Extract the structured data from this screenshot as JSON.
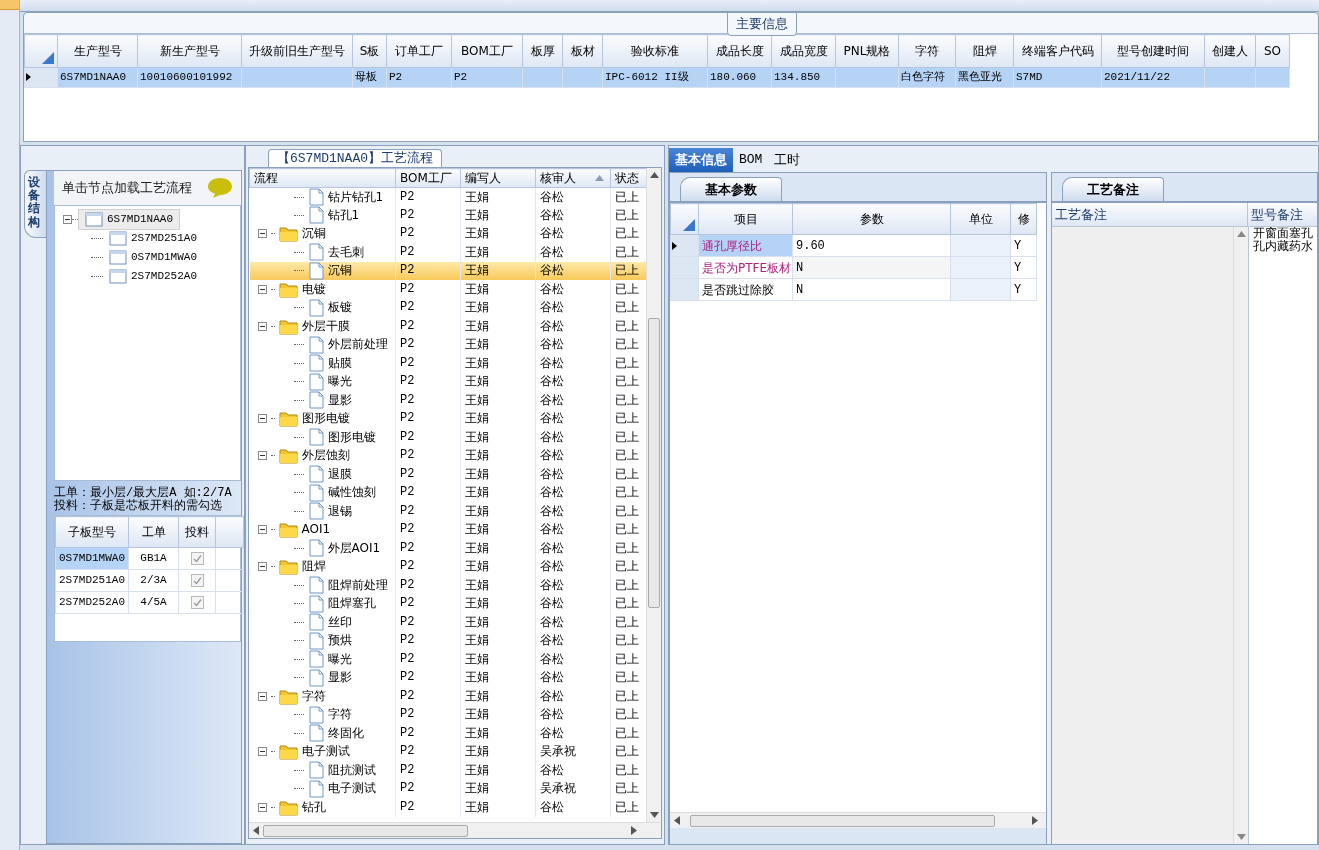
{
  "main_info": {
    "title": "主要信息",
    "columns": [
      "生产型号",
      "新生产型号",
      "升级前旧生产型号",
      "S板",
      "订单工厂",
      "BOM工厂",
      "板厚",
      "板材",
      "验收标准",
      "成品长度",
      "成品宽度",
      "PNL规格",
      "字符",
      "阻焊",
      "终端客户代码",
      "型号创建时间",
      "创建人",
      "SO"
    ],
    "rows": [
      {
        "selected": true,
        "cells": [
          "6S7MD1NAA0",
          "10010600101992",
          null,
          "母板",
          "P2",
          "P2",
          null,
          null,
          "IPC-6012 II级",
          "180.060",
          "134.850",
          null,
          "白色字符",
          "黑色亚光",
          "S7MD",
          "2021/11/22",
          null,
          null
        ]
      }
    ]
  },
  "structure_panel": {
    "side_tab": "设备结构",
    "hint": "单击节点加载工艺流程",
    "tree": [
      {
        "label": "6S7MD1NAA0",
        "expanded": true,
        "selected": true,
        "children": [
          {
            "label": "2S7MD251A0",
            "selected": false
          },
          {
            "label": "0S7MD1MWA0",
            "selected": false
          },
          {
            "label": "2S7MD252A0",
            "selected": false
          }
        ]
      }
    ],
    "notes": [
      "工单：最小层/最大层A 如:2/7A",
      "投料：子板是芯板开料的需勾选"
    ],
    "sub_boards": {
      "columns": [
        "子板型号",
        "工单",
        "投料"
      ],
      "rows": [
        {
          "model": "0S7MD1MWA0",
          "work_order": "GB1A",
          "feed": true,
          "selected": true
        },
        {
          "model": "2S7MD251A0",
          "work_order": "2/3A",
          "feed": true,
          "selected": false
        },
        {
          "model": "2S7MD252A0",
          "work_order": "4/5A",
          "feed": true,
          "selected": false
        }
      ]
    }
  },
  "process": {
    "title": "【6S7MD1NAA0】工艺流程",
    "columns": [
      {
        "label": "流程"
      },
      {
        "label": "BOM工厂"
      },
      {
        "label": "编写人"
      },
      {
        "label": "核审人",
        "sorted": true
      },
      {
        "label": "状态"
      }
    ],
    "rows": [
      {
        "kind": "continued",
        "children": [
          {
            "kind": "step",
            "name": "钻片钻孔1",
            "bom": "P2",
            "writer": "王娟",
            "reviewer": "谷松",
            "status": "已上",
            "selected": false
          },
          {
            "kind": "step",
            "name": "钻孔1",
            "bom": "P2",
            "writer": "王娟",
            "reviewer": "谷松",
            "status": "已上",
            "selected": false
          }
        ]
      },
      {
        "kind": "folder",
        "name": "沉铜",
        "expanded": true,
        "bom": "P2",
        "writer": "王娟",
        "reviewer": "谷松",
        "status": "已上",
        "selected": false,
        "children": [
          {
            "kind": "step",
            "name": "去毛刺",
            "bom": "P2",
            "writer": "王娟",
            "reviewer": "谷松",
            "status": "已上",
            "selected": false
          },
          {
            "kind": "step",
            "name": "沉铜",
            "bom": "P2",
            "writer": "王娟",
            "reviewer": "谷松",
            "status": "已上",
            "selected": true
          }
        ]
      },
      {
        "kind": "folder",
        "name": "电镀",
        "expanded": true,
        "bom": "P2",
        "writer": "王娟",
        "reviewer": "谷松",
        "status": "已上",
        "selected": false,
        "children": [
          {
            "kind": "step",
            "name": "板镀",
            "bom": "P2",
            "writer": "王娟",
            "reviewer": "谷松",
            "status": "已上",
            "selected": false
          }
        ]
      },
      {
        "kind": "folder",
        "name": "外层干膜",
        "expanded": true,
        "bom": "P2",
        "writer": "王娟",
        "reviewer": "谷松",
        "status": "已上",
        "selected": false,
        "children": [
          {
            "kind": "step",
            "name": "外层前处理",
            "bom": "P2",
            "writer": "王娟",
            "reviewer": "谷松",
            "status": "已上",
            "selected": false
          },
          {
            "kind": "step",
            "name": "贴膜",
            "bom": "P2",
            "writer": "王娟",
            "reviewer": "谷松",
            "status": "已上",
            "selected": false
          },
          {
            "kind": "step",
            "name": "曝光",
            "bom": "P2",
            "writer": "王娟",
            "reviewer": "谷松",
            "status": "已上",
            "selected": false
          },
          {
            "kind": "step",
            "name": "显影",
            "bom": "P2",
            "writer": "王娟",
            "reviewer": "谷松",
            "status": "已上",
            "selected": false
          }
        ]
      },
      {
        "kind": "folder",
        "name": "图形电镀",
        "expanded": true,
        "bom": "P2",
        "writer": "王娟",
        "reviewer": "谷松",
        "status": "已上",
        "selected": false,
        "children": [
          {
            "kind": "step",
            "name": "图形电镀",
            "bom": "P2",
            "writer": "王娟",
            "reviewer": "谷松",
            "status": "已上",
            "selected": false
          }
        ]
      },
      {
        "kind": "folder",
        "name": "外层蚀刻",
        "expanded": true,
        "bom": "P2",
        "writer": "王娟",
        "reviewer": "谷松",
        "status": "已上",
        "selected": false,
        "children": [
          {
            "kind": "step",
            "name": "退膜",
            "bom": "P2",
            "writer": "王娟",
            "reviewer": "谷松",
            "status": "已上",
            "selected": false
          },
          {
            "kind": "step",
            "name": "碱性蚀刻",
            "bom": "P2",
            "writer": "王娟",
            "reviewer": "谷松",
            "status": "已上",
            "selected": false
          },
          {
            "kind": "step",
            "name": "退锡",
            "bom": "P2",
            "writer": "王娟",
            "reviewer": "谷松",
            "status": "已上",
            "selected": false
          }
        ]
      },
      {
        "kind": "folder",
        "name": "AOI1",
        "expanded": true,
        "bom": "P2",
        "writer": "王娟",
        "reviewer": "谷松",
        "status": "已上",
        "selected": false,
        "children": [
          {
            "kind": "step",
            "name": "外层AOI1",
            "bom": "P2",
            "writer": "王娟",
            "reviewer": "谷松",
            "status": "已上",
            "selected": false
          }
        ]
      },
      {
        "kind": "folder",
        "name": "阻焊",
        "expanded": true,
        "bom": "P2",
        "writer": "王娟",
        "reviewer": "谷松",
        "status": "已上",
        "selected": false,
        "children": [
          {
            "kind": "step",
            "name": "阻焊前处理",
            "bom": "P2",
            "writer": "王娟",
            "reviewer": "谷松",
            "status": "已上",
            "selected": false
          },
          {
            "kind": "step",
            "name": "阻焊塞孔",
            "bom": "P2",
            "writer": "王娟",
            "reviewer": "谷松",
            "status": "已上",
            "selected": false
          },
          {
            "kind": "step",
            "name": "丝印",
            "bom": "P2",
            "writer": "王娟",
            "reviewer": "谷松",
            "status": "已上",
            "selected": false
          },
          {
            "kind": "step",
            "name": "预烘",
            "bom": "P2",
            "writer": "王娟",
            "reviewer": "谷松",
            "status": "已上",
            "selected": false
          },
          {
            "kind": "step",
            "name": "曝光",
            "bom": "P2",
            "writer": "王娟",
            "reviewer": "谷松",
            "status": "已上",
            "selected": false
          },
          {
            "kind": "step",
            "name": "显影",
            "bom": "P2",
            "writer": "王娟",
            "reviewer": "谷松",
            "status": "已上",
            "selected": false
          }
        ]
      },
      {
        "kind": "folder",
        "name": "字符",
        "expanded": true,
        "bom": "P2",
        "writer": "王娟",
        "reviewer": "谷松",
        "status": "已上",
        "selected": false,
        "children": [
          {
            "kind": "step",
            "name": "字符",
            "bom": "P2",
            "writer": "王娟",
            "reviewer": "谷松",
            "status": "已上",
            "selected": false
          },
          {
            "kind": "step",
            "name": "终固化",
            "bom": "P2",
            "writer": "王娟",
            "reviewer": "谷松",
            "status": "已上",
            "selected": false
          }
        ]
      },
      {
        "kind": "folder",
        "name": "电子测试",
        "expanded": true,
        "bom": "P2",
        "writer": "王娟",
        "reviewer": "吴承祝",
        "status": "已上",
        "selected": false,
        "children": [
          {
            "kind": "step",
            "name": "阻抗测试",
            "bom": "P2",
            "writer": "王娟",
            "reviewer": "谷松",
            "status": "已上",
            "selected": false
          },
          {
            "kind": "step",
            "name": "电子测试",
            "bom": "P2",
            "writer": "王娟",
            "reviewer": "吴承祝",
            "status": "已上",
            "selected": false
          }
        ]
      },
      {
        "kind": "folder",
        "name": "钻孔",
        "expanded": true,
        "bom": "P2",
        "writer": "王娟",
        "reviewer": "谷松",
        "status": "已上",
        "selected": false
      }
    ]
  },
  "detail": {
    "tabs": [
      {
        "label": "基本信息",
        "selected": true
      },
      {
        "label": "BOM",
        "selected": false
      },
      {
        "label": "工时",
        "selected": false
      }
    ],
    "params": {
      "tab": "基本参数",
      "columns": [
        "项目",
        "参数",
        "单位",
        "修"
      ],
      "rows": [
        {
          "item": "通孔厚径比",
          "value": "9.60",
          "flag": "Y",
          "highlighted": true,
          "selected": true
        },
        {
          "item": "是否为PTFE板材",
          "value": "N",
          "flag": "Y",
          "highlighted": true,
          "selected": false
        },
        {
          "item": "是否跳过除胶",
          "value": "N",
          "flag": "Y",
          "highlighted": false,
          "selected": false
        }
      ]
    },
    "remarks": {
      "tab": "工艺备注",
      "columns": [
        "工艺备注",
        "型号备注"
      ],
      "model_remark": [
        "开窗面塞孔",
        "孔内藏药水"
      ]
    }
  }
}
